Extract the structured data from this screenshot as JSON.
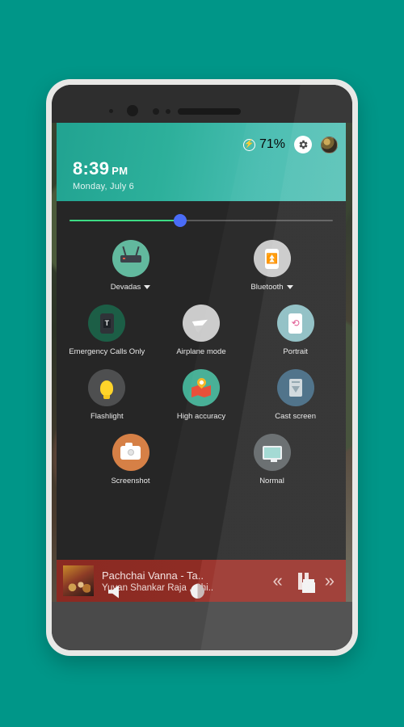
{
  "background": {
    "color": "#009688"
  },
  "status_bar": {
    "battery_icon": "battery-charging-icon",
    "battery_percent": "71%",
    "settings_icon": "gear-icon",
    "avatar": "user-avatar"
  },
  "header": {
    "time": "8:39",
    "ampm": "PM",
    "date": "Monday, July 6",
    "gradient_start": "#21a391",
    "gradient_end": "#56c2b6"
  },
  "brightness": {
    "label": "brightness-slider",
    "value": 42,
    "fill_color": "#3ddc84",
    "thumb_color": "#4a6cf7",
    "track_color": "#5a5a5a"
  },
  "tiles": {
    "row1": [
      {
        "label": "Devadas",
        "icon": "wifi-router-icon",
        "has_caret": true,
        "circle_color": "#6ecfb0"
      },
      {
        "label": "Bluetooth",
        "icon": "bluetooth-icon",
        "has_caret": true,
        "circle_color": "#e0e0e0"
      }
    ],
    "row2": [
      {
        "label": "Emergency Calls Only",
        "icon": "cellular-signal-icon",
        "has_caret": false,
        "circle_color": "#20694f"
      },
      {
        "label": "Airplane mode",
        "icon": "airplane-icon",
        "has_caret": false,
        "circle_color": "#e3e3e3"
      },
      {
        "label": "Portrait",
        "icon": "screen-rotation-icon",
        "has_caret": false,
        "circle_color": "#9bd3d8"
      }
    ],
    "row3": [
      {
        "label": "Flashlight",
        "icon": "flashlight-bulb-icon",
        "has_caret": false,
        "circle_color": "#57585a"
      },
      {
        "label": "High accuracy",
        "icon": "location-map-pin-icon",
        "has_caret": false,
        "circle_color": "#4cc2a5"
      },
      {
        "label": "Cast screen",
        "icon": "cast-screen-icon",
        "has_caret": false,
        "circle_color": "#4a7490"
      }
    ],
    "row4": [
      {
        "label": "Screenshot",
        "icon": "camera-screenshot-icon",
        "has_caret": false,
        "circle_color": "#ef8f4e"
      },
      {
        "label": "Normal",
        "icon": "display-monitor-icon",
        "has_caret": false,
        "circle_color": "#6b7173"
      }
    ]
  },
  "music_widget": {
    "title": "Pachchai Vanna -  Ta..",
    "artist": "Yuvan Shankar Raja , Chi..",
    "album_art": "album-artwork",
    "previous_icon": "«",
    "pause_icon": "pause-icon",
    "next_icon": "»",
    "background_color": "#8b2a22"
  },
  "device": {
    "bezel_color": "#e8e8e6",
    "body_color": "#2b2b2b",
    "bottom_bezel_color": "#4a4a4a",
    "earpiece": "earpiece-speaker",
    "front_camera": "front-camera"
  },
  "home_icon_colors": [
    "#2f6fa8",
    "#1f7a5c",
    "#c9c9c9",
    "#d8d8d8",
    "#2a5ea8",
    "#c03a2b",
    "#2f7fbd"
  ]
}
